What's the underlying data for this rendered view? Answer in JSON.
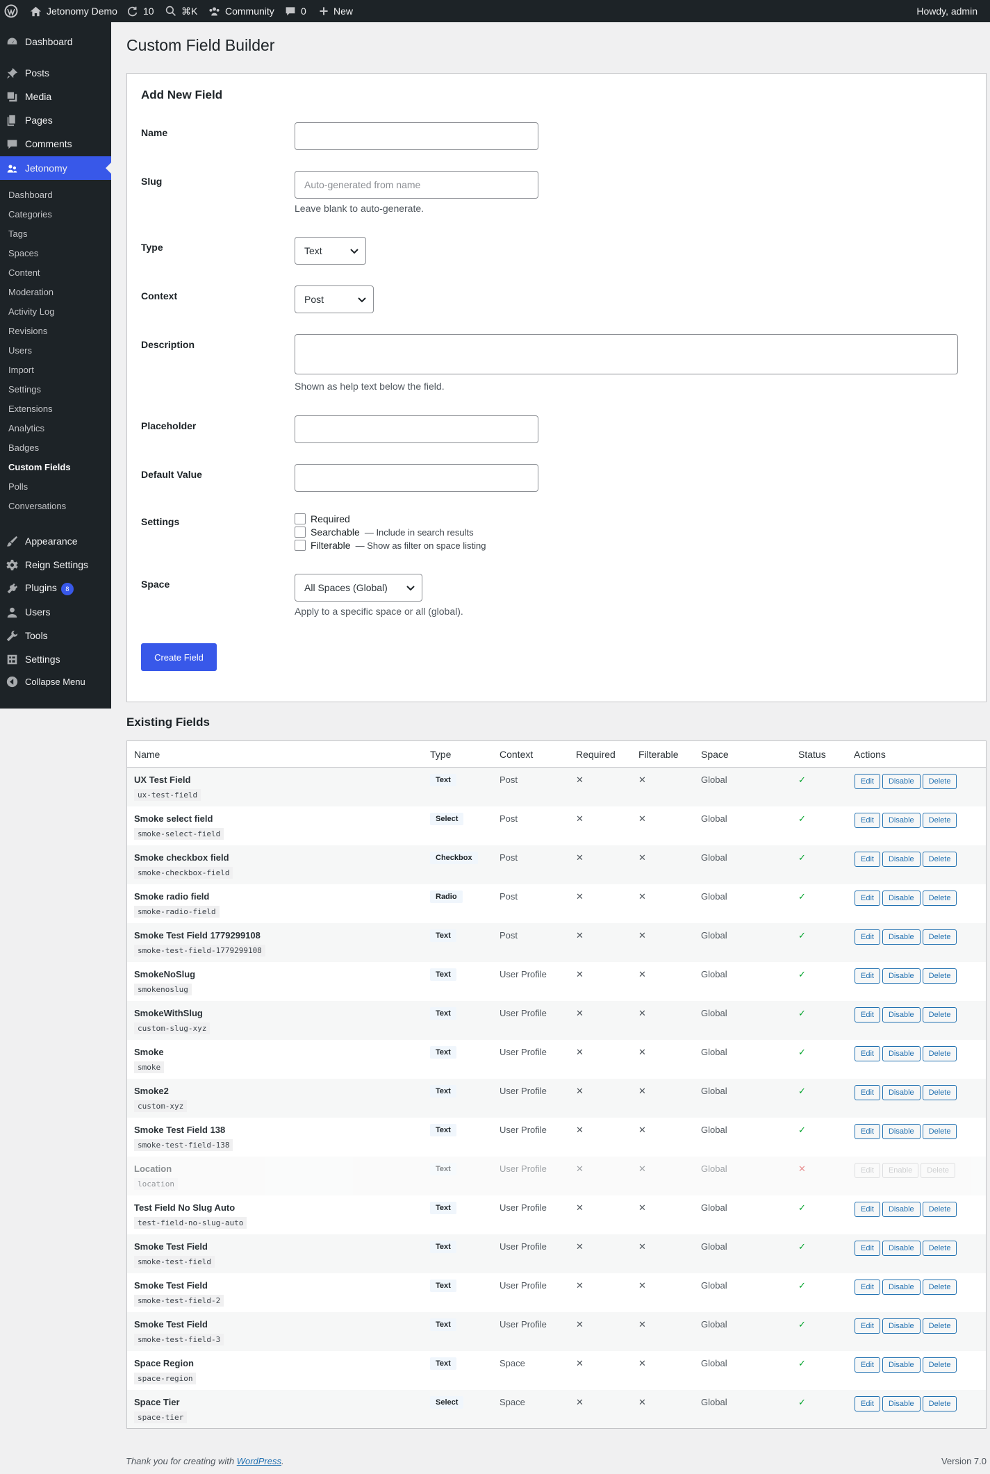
{
  "adminbar": {
    "site_name": "Jetonomy Demo",
    "updates": "10",
    "search_shortcut": "⌘K",
    "community": "Community",
    "comments": "0",
    "new": "New",
    "howdy": "Howdy, admin"
  },
  "sidebar": {
    "top": [
      {
        "label": "Dashboard",
        "icon": "gauge-icon"
      }
    ],
    "group1": [
      {
        "label": "Posts",
        "icon": "pin-icon"
      },
      {
        "label": "Media",
        "icon": "media-icon"
      },
      {
        "label": "Pages",
        "icon": "pages-icon"
      },
      {
        "label": "Comments",
        "icon": "comment-icon"
      }
    ],
    "current": {
      "label": "Jetonomy",
      "icon": "jetonomy-icon"
    },
    "submenu": [
      "Dashboard",
      "Categories",
      "Tags",
      "Spaces",
      "Content",
      "Moderation",
      "Activity Log",
      "Revisions",
      "Users",
      "Import",
      "Settings",
      "Extensions",
      "Analytics",
      "Badges",
      "Custom Fields",
      "Polls",
      "Conversations"
    ],
    "submenu_active": "Custom Fields",
    "group2": [
      {
        "label": "Appearance",
        "icon": "brush-icon"
      },
      {
        "label": "Reign Settings",
        "icon": "gear-icon"
      },
      {
        "label": "Plugins",
        "icon": "plug-icon",
        "badge": "8"
      },
      {
        "label": "Users",
        "icon": "user-icon"
      },
      {
        "label": "Tools",
        "icon": "wrench-icon"
      },
      {
        "label": "Settings",
        "icon": "settings-icon"
      },
      {
        "label": "Collapse Menu",
        "icon": "collapse-icon"
      }
    ]
  },
  "page": {
    "title": "Custom Field Builder"
  },
  "form": {
    "heading": "Add New Field",
    "name": {
      "label": "Name",
      "value": ""
    },
    "slug": {
      "label": "Slug",
      "placeholder": "Auto-generated from name",
      "help": "Leave blank to auto-generate."
    },
    "type": {
      "label": "Type",
      "value": "Text"
    },
    "context": {
      "label": "Context",
      "value": "Post"
    },
    "description": {
      "label": "Description",
      "help": "Shown as help text below the field."
    },
    "placeholder": {
      "label": "Placeholder"
    },
    "default_value": {
      "label": "Default Value"
    },
    "settings": {
      "label": "Settings",
      "options": [
        {
          "label": "Required",
          "desc": ""
        },
        {
          "label": "Searchable",
          "desc": "— Include in search results"
        },
        {
          "label": "Filterable",
          "desc": "— Show as filter on space listing"
        }
      ]
    },
    "space": {
      "label": "Space",
      "value": "All Spaces (Global)",
      "help": "Apply to a specific space or all (global)."
    },
    "submit": "Create Field"
  },
  "existing": {
    "heading": "Existing Fields",
    "columns": [
      "Name",
      "Type",
      "Context",
      "Required",
      "Filterable",
      "Space",
      "Status",
      "Actions"
    ],
    "actions": {
      "edit": "Edit",
      "disable": "Disable",
      "enable": "Enable",
      "delete": "Delete"
    },
    "rows": [
      {
        "name": "UX Test Field",
        "slug": "ux-test-field",
        "type": "Text",
        "context": "Post",
        "required": "✕",
        "filterable": "✕",
        "space": "Global",
        "status": "✓",
        "active": true
      },
      {
        "name": "Smoke select field",
        "slug": "smoke-select-field",
        "type": "Select",
        "context": "Post",
        "required": "✕",
        "filterable": "✕",
        "space": "Global",
        "status": "✓",
        "active": true
      },
      {
        "name": "Smoke checkbox field",
        "slug": "smoke-checkbox-field",
        "type": "Checkbox",
        "context": "Post",
        "required": "✕",
        "filterable": "✕",
        "space": "Global",
        "status": "✓",
        "active": true
      },
      {
        "name": "Smoke radio field",
        "slug": "smoke-radio-field",
        "type": "Radio",
        "context": "Post",
        "required": "✕",
        "filterable": "✕",
        "space": "Global",
        "status": "✓",
        "active": true
      },
      {
        "name": "Smoke Test Field 1779299108",
        "slug": "smoke-test-field-1779299108",
        "type": "Text",
        "context": "Post",
        "required": "✕",
        "filterable": "✕",
        "space": "Global",
        "status": "✓",
        "active": true
      },
      {
        "name": "SmokeNoSlug",
        "slug": "smokenoslug",
        "type": "Text",
        "context": "User Profile",
        "required": "✕",
        "filterable": "✕",
        "space": "Global",
        "status": "✓",
        "active": true
      },
      {
        "name": "SmokeWithSlug",
        "slug": "custom-slug-xyz",
        "type": "Text",
        "context": "User Profile",
        "required": "✕",
        "filterable": "✕",
        "space": "Global",
        "status": "✓",
        "active": true
      },
      {
        "name": "Smoke",
        "slug": "smoke",
        "type": "Text",
        "context": "User Profile",
        "required": "✕",
        "filterable": "✕",
        "space": "Global",
        "status": "✓",
        "active": true
      },
      {
        "name": "Smoke2",
        "slug": "custom-xyz",
        "type": "Text",
        "context": "User Profile",
        "required": "✕",
        "filterable": "✕",
        "space": "Global",
        "status": "✓",
        "active": true
      },
      {
        "name": "Smoke Test Field 138",
        "slug": "smoke-test-field-138",
        "type": "Text",
        "context": "User Profile",
        "required": "✕",
        "filterable": "✕",
        "space": "Global",
        "status": "✓",
        "active": true
      },
      {
        "name": "Location",
        "slug": "location",
        "type": "Text",
        "context": "User Profile",
        "required": "✕",
        "filterable": "✕",
        "space": "Global",
        "status": "✕",
        "active": false
      },
      {
        "name": "Test Field No Slug Auto",
        "slug": "test-field-no-slug-auto",
        "type": "Text",
        "context": "User Profile",
        "required": "✕",
        "filterable": "✕",
        "space": "Global",
        "status": "✓",
        "active": true
      },
      {
        "name": "Smoke Test Field",
        "slug": "smoke-test-field",
        "type": "Text",
        "context": "User Profile",
        "required": "✕",
        "filterable": "✕",
        "space": "Global",
        "status": "✓",
        "active": true
      },
      {
        "name": "Smoke Test Field",
        "slug": "smoke-test-field-2",
        "type": "Text",
        "context": "User Profile",
        "required": "✕",
        "filterable": "✕",
        "space": "Global",
        "status": "✓",
        "active": true
      },
      {
        "name": "Smoke Test Field",
        "slug": "smoke-test-field-3",
        "type": "Text",
        "context": "User Profile",
        "required": "✕",
        "filterable": "✕",
        "space": "Global",
        "status": "✓",
        "active": true
      },
      {
        "name": "Space Region",
        "slug": "space-region",
        "type": "Text",
        "context": "Space",
        "required": "✕",
        "filterable": "✕",
        "space": "Global",
        "status": "✓",
        "active": true
      },
      {
        "name": "Space Tier",
        "slug": "space-tier",
        "type": "Select",
        "context": "Space",
        "required": "✕",
        "filterable": "✕",
        "space": "Global",
        "status": "✓",
        "active": true
      }
    ]
  },
  "footer": {
    "thanks": "Thank you for creating with ",
    "link": "WordPress",
    "period": ".",
    "version": "Version 7.0"
  }
}
